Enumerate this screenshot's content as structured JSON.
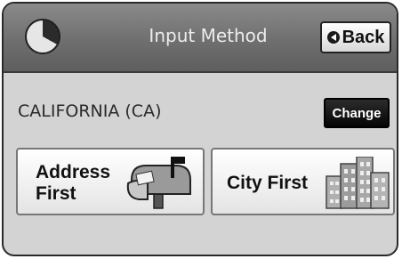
{
  "header": {
    "title": "Input Method",
    "back_label": "Back",
    "logo_icon": "pie-logo-icon",
    "back_icon": "back-arrow-icon"
  },
  "location": {
    "state": "CALIFORNIA (CA)",
    "change_label": "Change"
  },
  "options": [
    {
      "label": "Address\nFirst",
      "icon": "mailbox-icon"
    },
    {
      "label": "City First",
      "icon": "city-buildings-icon"
    }
  ],
  "colors": {
    "titlebar": "#6f6f6f",
    "panel": "#d3d3d3",
    "change_button": "#111111"
  }
}
